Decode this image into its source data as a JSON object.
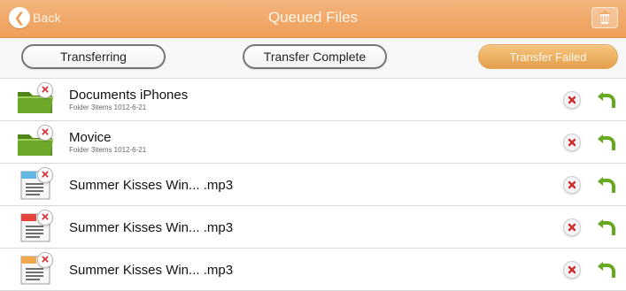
{
  "window": {
    "title": "Queued Files",
    "back_label": "Back",
    "back_icon": "back-icon",
    "trash_icon": "trash-icon"
  },
  "tabs": [
    {
      "label": "Transferring",
      "selected": false
    },
    {
      "label": "Transfer Complete",
      "selected": false
    },
    {
      "label": "Transfer Failed",
      "selected": true
    }
  ],
  "files": [
    {
      "name": "Documents iPhones",
      "meta": "Folder  3items  1012-6-21",
      "icon": "folder-icon"
    },
    {
      "name": "Movice",
      "meta": "Folder  3items  1012-6-21",
      "icon": "folder-icon"
    },
    {
      "name": "Summer Kisses Win...  .mp3",
      "meta": "",
      "icon": "audio-file-blue-icon"
    },
    {
      "name": "Summer Kisses Win...  .mp3",
      "meta": "",
      "icon": "audio-file-red-icon"
    },
    {
      "name": "Summer Kisses Win...  .mp3",
      "meta": "",
      "icon": "audio-file-orange-icon"
    }
  ],
  "actions": {
    "remove_icon": "remove-icon",
    "retry_icon": "retry-icon"
  },
  "colors": {
    "accent": "#ef9f59",
    "remove_red": "#cf2b2b",
    "retry_green": "#67a821",
    "folder_green": "#5f981f"
  }
}
